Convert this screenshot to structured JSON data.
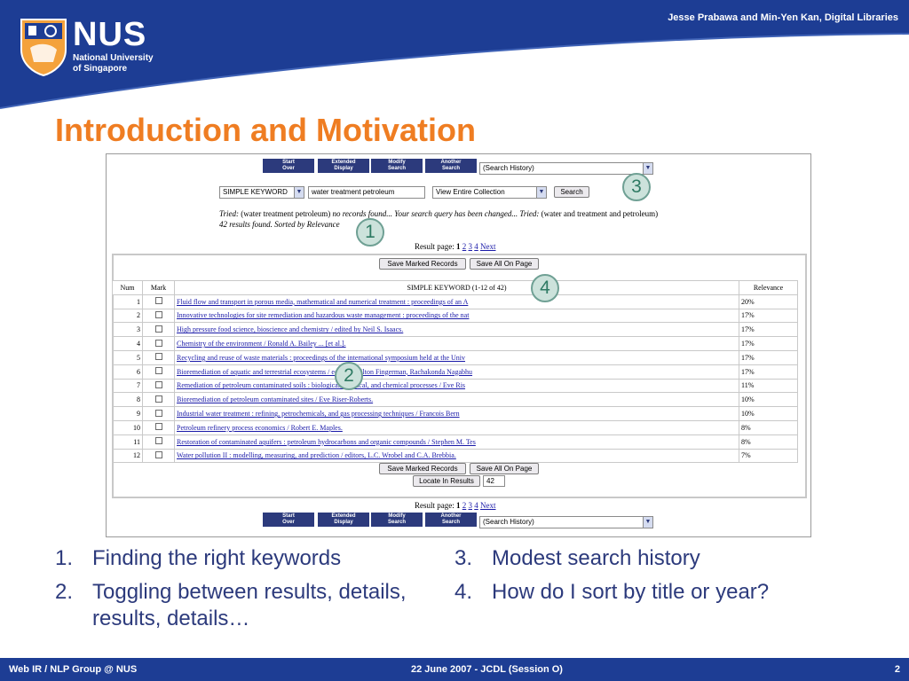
{
  "header": {
    "author": "Jesse Prabawa and Min-Yen Kan, Digital Libraries",
    "logo": {
      "name": "NUS",
      "line1": "National University",
      "line2": "of Singapore"
    }
  },
  "title": "Introduction and Motivation",
  "screenshot": {
    "nav_buttons": [
      {
        "line1": "Start",
        "line2": "Over"
      },
      {
        "line1": "Extended",
        "line2": "Display"
      },
      {
        "line1": "Modify",
        "line2": "Search"
      },
      {
        "line1": "Another",
        "line2": "Search"
      }
    ],
    "history_select": "(Search History)",
    "search_type": "SIMPLE KEYWORD",
    "query": "water treatment petroleum",
    "collection": "View Entire Collection",
    "search_button": "Search",
    "tried_label": "Tried:",
    "tried_query": "(water treatment petroleum)",
    "tried_message": "no records found... Your search query has been changed... Tried:",
    "tried_query2": "(water and treatment and petroleum)",
    "found": "42 results found. Sorted by Relevance",
    "result_page_label": "Result page:",
    "pages": [
      "1",
      "2",
      "3",
      "4"
    ],
    "next": "Next",
    "save_marked": "Save Marked Records",
    "save_all": "Save All On Page",
    "locate": "Locate In Results",
    "locate_value": "42",
    "table_headers": {
      "num": "Num",
      "mark": "Mark",
      "title": "SIMPLE KEYWORD (1-12 of 42)",
      "relevance": "Relevance"
    },
    "rows": [
      {
        "num": "1",
        "title": "Fluid flow and transport in porous media, mathematical and numerical treatment : proceedings of an A",
        "relevance": "20%"
      },
      {
        "num": "2",
        "title": "Innovative technologies for site remediation and hazardous waste management : proceedings of the nat",
        "relevance": "17%"
      },
      {
        "num": "3",
        "title": "High pressure food science, bioscience and chemistry / edited by Neil S. Isaacs.",
        "relevance": "17%"
      },
      {
        "num": "4",
        "title": "Chemistry of the environment / Ronald A. Bailey ... [et al.].",
        "relevance": "17%"
      },
      {
        "num": "5",
        "title": "Recycling and reuse of waste materials : proceedings of the international symposium held at the Univ",
        "relevance": "17%"
      },
      {
        "num": "6",
        "title": "Bioremediation of aquatic and terrestrial ecosystems / editors, Milton Fingerman, Rachakonda Nagabhu",
        "relevance": "17%"
      },
      {
        "num": "7",
        "title": "Remediation of petroleum contaminated soils : biological, physical, and chemical processes / Eve Ris",
        "relevance": "11%"
      },
      {
        "num": "8",
        "title": "Bioremediation of petroleum contaminated sites / Eve Riser-Roberts.",
        "relevance": "10%"
      },
      {
        "num": "9",
        "title": "Industrial water treatment : refining, petrochemicals, and gas processing techniques / Francois Bern",
        "relevance": "10%"
      },
      {
        "num": "10",
        "title": "Petroleum refinery process economics / Robert E. Maples.",
        "relevance": "8%"
      },
      {
        "num": "11",
        "title": "Restoration of contaminated aquifers : petroleum hydrocarbons and organic compounds / Stephen M. Tes",
        "relevance": "8%"
      },
      {
        "num": "12",
        "title": "Water pollution II : modelling, measuring, and prediction / editors, L.C. Wrobel and C.A. Brebbia.",
        "relevance": "7%"
      }
    ],
    "callouts": [
      "1",
      "2",
      "3",
      "4"
    ]
  },
  "bullets_left": [
    {
      "n": "1.",
      "text": "Finding the right keywords"
    },
    {
      "n": "2.",
      "text": "Toggling between results, details, results, details…"
    }
  ],
  "bullets_right": [
    {
      "n": "3.",
      "text": "Modest search history"
    },
    {
      "n": "4.",
      "text": "How do I sort by title or year?"
    }
  ],
  "footer": {
    "left": "Web IR / NLP Group @ NUS",
    "center": "22 June 2007 - JCDL (Session O)",
    "page": "2"
  },
  "colors": {
    "brand_blue": "#1d3d94",
    "title_orange": "#ef7d22",
    "text_navy": "#2c3a7c"
  }
}
